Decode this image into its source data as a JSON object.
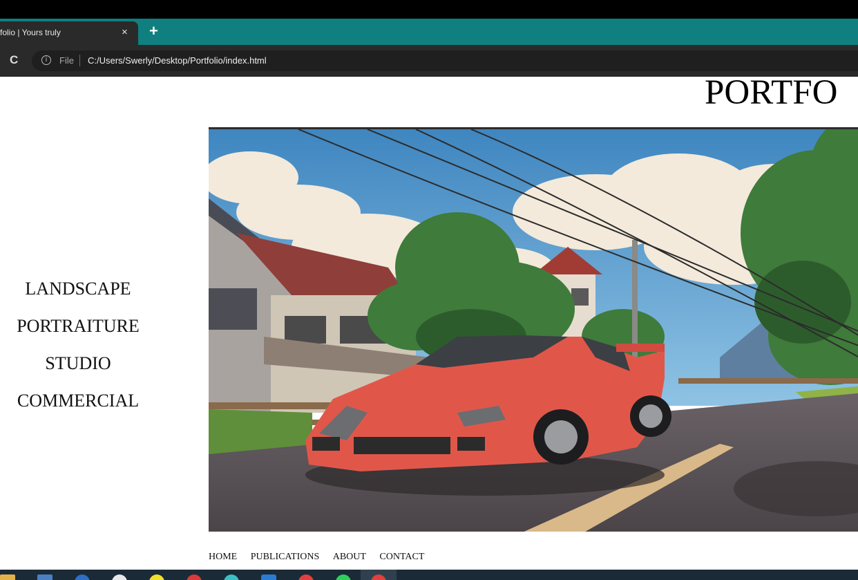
{
  "browser": {
    "tab_title": "folio | Yours truly",
    "tab_close": "×",
    "new_tab": "+",
    "reload": "C",
    "info": "i",
    "scheme": "File",
    "url": "C:/Users/Swerly/Desktop/Portfolio/index.html"
  },
  "page": {
    "title": "PORTFO",
    "side_nav": [
      "LANDSCAPE",
      "PORTRAITURE",
      "STUDIO",
      "COMMERCIAL"
    ],
    "bottom_nav": [
      "HOME",
      "PUBLICATIONS",
      "ABOUT",
      "CONTACT"
    ]
  },
  "colors": {
    "tab_strip": "#0f7f7f",
    "car": "#e0574a",
    "sky": "#4a8fc4"
  },
  "taskbar": {
    "icons": [
      "file-explorer-icon",
      "network-icon",
      "app-icon-blue",
      "app-icon-white",
      "app-icon-yellow",
      "app-icon-red",
      "app-icon-teal",
      "vscode-icon",
      "app-icon-red-2",
      "app-icon-green",
      "app-icon-active"
    ]
  }
}
